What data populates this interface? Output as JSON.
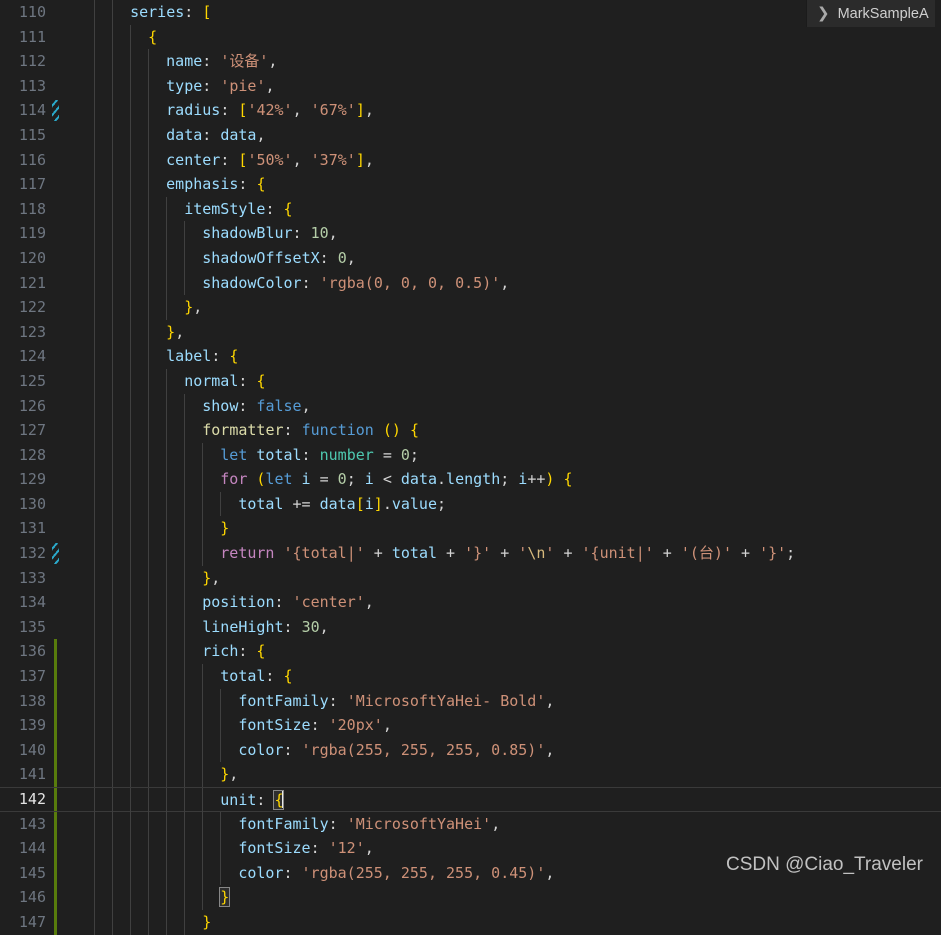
{
  "breadcrumb": {
    "chevron_icon": "chevron-right-icon",
    "label": "MarkSampleA"
  },
  "watermark": "CSDN @Ciao_Traveler",
  "editor": {
    "background_color": "#1f1f1f",
    "first_line_number": 110,
    "active_line": 142,
    "change_marker_lines": [
      114,
      132
    ],
    "added_marker_lines": [
      136,
      137,
      138,
      139,
      140,
      141,
      142,
      143,
      144,
      145,
      146,
      147
    ],
    "lines": [
      {
        "n": 110,
        "text": "    series: ["
      },
      {
        "n": 111,
        "text": "      {"
      },
      {
        "n": 112,
        "text": "        name: '设备',"
      },
      {
        "n": 113,
        "text": "        type: 'pie',"
      },
      {
        "n": 114,
        "text": "        radius: ['42%', '67%'],"
      },
      {
        "n": 115,
        "text": "        data: data,"
      },
      {
        "n": 116,
        "text": "        center: ['50%', '37%'],"
      },
      {
        "n": 117,
        "text": "        emphasis: {"
      },
      {
        "n": 118,
        "text": "          itemStyle: {"
      },
      {
        "n": 119,
        "text": "            shadowBlur: 10,"
      },
      {
        "n": 120,
        "text": "            shadowOffsetX: 0,"
      },
      {
        "n": 121,
        "text": "            shadowColor: 'rgba(0, 0, 0, 0.5)',"
      },
      {
        "n": 122,
        "text": "          },"
      },
      {
        "n": 123,
        "text": "        },"
      },
      {
        "n": 124,
        "text": "        label: {"
      },
      {
        "n": 125,
        "text": "          normal: {"
      },
      {
        "n": 126,
        "text": "            show: false,"
      },
      {
        "n": 127,
        "text": "            formatter: function () {"
      },
      {
        "n": 128,
        "text": "              let total: number = 0;"
      },
      {
        "n": 129,
        "text": "              for (let i = 0; i < data.length; i++) {"
      },
      {
        "n": 130,
        "text": "                total += data[i].value;"
      },
      {
        "n": 131,
        "text": "              }"
      },
      {
        "n": 132,
        "text": "              return '{total|' + total + '}' + '\\n' + '{unit|' + '(台)' + '}';"
      },
      {
        "n": 133,
        "text": "            },"
      },
      {
        "n": 134,
        "text": "            position: 'center',"
      },
      {
        "n": 135,
        "text": "            lineHight: 30,"
      },
      {
        "n": 136,
        "text": "            rich: {"
      },
      {
        "n": 137,
        "text": "              total: {"
      },
      {
        "n": 138,
        "text": "                fontFamily: 'MicrosoftYaHei- Bold',"
      },
      {
        "n": 139,
        "text": "                fontSize: '20px',"
      },
      {
        "n": 140,
        "text": "                color: 'rgba(255, 255, 255, 0.85)',"
      },
      {
        "n": 141,
        "text": "              },"
      },
      {
        "n": 142,
        "text": "              unit: {"
      },
      {
        "n": 143,
        "text": "                fontFamily: 'MicrosoftYaHei',"
      },
      {
        "n": 144,
        "text": "                fontSize: '12',"
      },
      {
        "n": 145,
        "text": "                color: 'rgba(255, 255, 255, 0.45)',"
      },
      {
        "n": 146,
        "text": "              }"
      },
      {
        "n": 147,
        "text": "            }"
      }
    ]
  }
}
